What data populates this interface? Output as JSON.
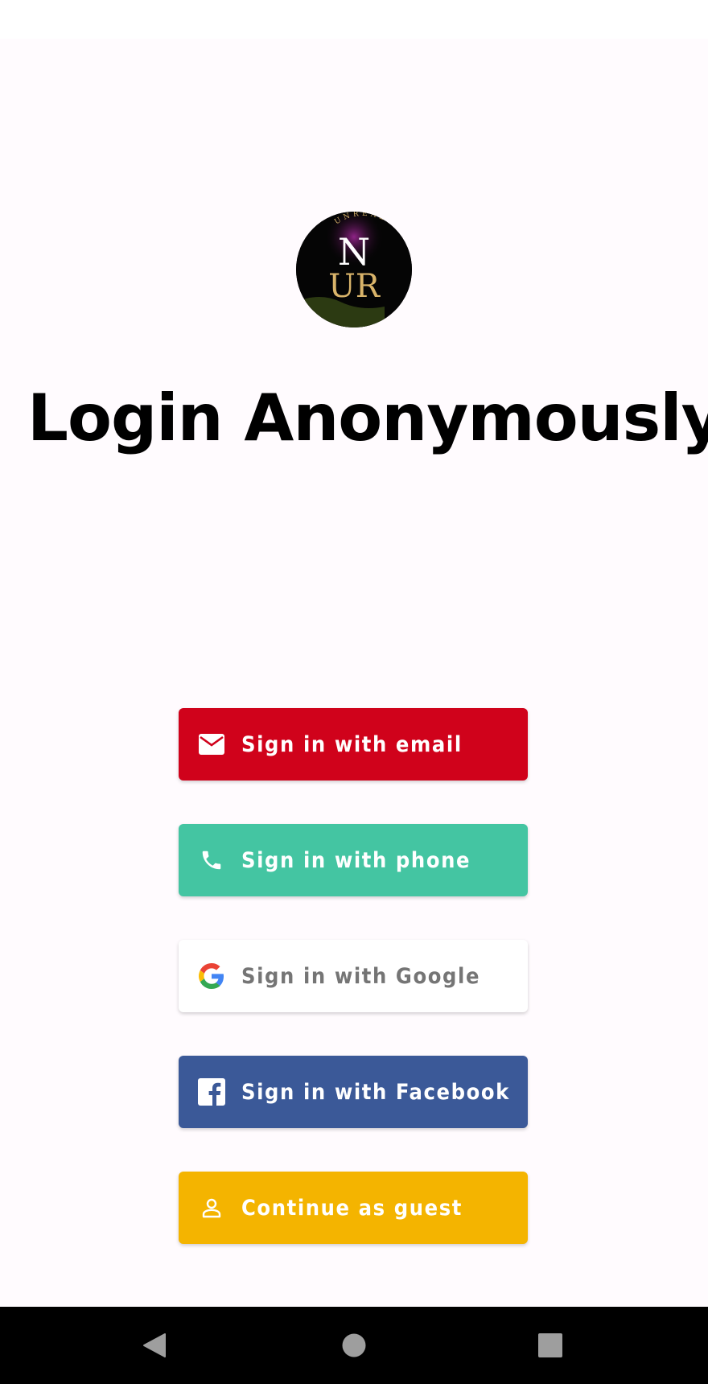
{
  "screen": {
    "title": "Login Anonymously"
  },
  "logo": {
    "monogram_top": "N",
    "monogram_bottom": "UR",
    "ring_text": "UNREALNET"
  },
  "auth_buttons": [
    {
      "label": "Sign in with email",
      "icon": "email-icon",
      "color": "#d0021b"
    },
    {
      "label": "Sign in with phone",
      "icon": "phone-icon",
      "color": "#44c5a2"
    },
    {
      "label": "Sign in with Google",
      "icon": "google-icon",
      "color": "#ffffff"
    },
    {
      "label": "Sign in with Facebook",
      "icon": "facebook-icon",
      "color": "#3b5998"
    },
    {
      "label": "Continue as guest",
      "icon": "person-icon",
      "color": "#f4b400"
    }
  ],
  "nav_bar": {
    "buttons": [
      "back-icon",
      "home-icon",
      "recents-icon"
    ]
  }
}
